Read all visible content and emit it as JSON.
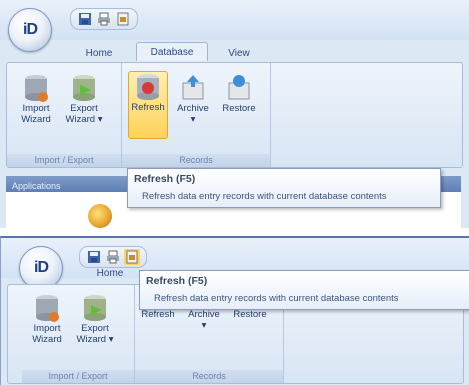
{
  "app": {
    "logo_text": "iD"
  },
  "tabs": [
    "Home",
    "Database",
    "View"
  ],
  "groups": {
    "import_export": {
      "label": "Import / Export",
      "import": "Import\nWizard",
      "export": "Export\nWizard ▾"
    },
    "records": {
      "label": "Records",
      "refresh": "Refresh",
      "archive": "Archive\n▾",
      "restore": "Restore"
    }
  },
  "applications_label": "Applications",
  "tooltip": {
    "title": "Refresh (F5)",
    "description": "Refresh data entry records with current database contents"
  },
  "icons": {
    "save": "floppy-disk-icon",
    "print": "printer-icon",
    "email": "envelope-icon",
    "import": "database-import-icon",
    "export": "database-export-icon",
    "refresh": "database-refresh-icon",
    "archive": "archive-box-icon",
    "restore": "restore-icon"
  },
  "colors": {
    "ribbon": "#dde8f5",
    "hot": "#ffd25a",
    "accent": "#1f3f8a"
  }
}
